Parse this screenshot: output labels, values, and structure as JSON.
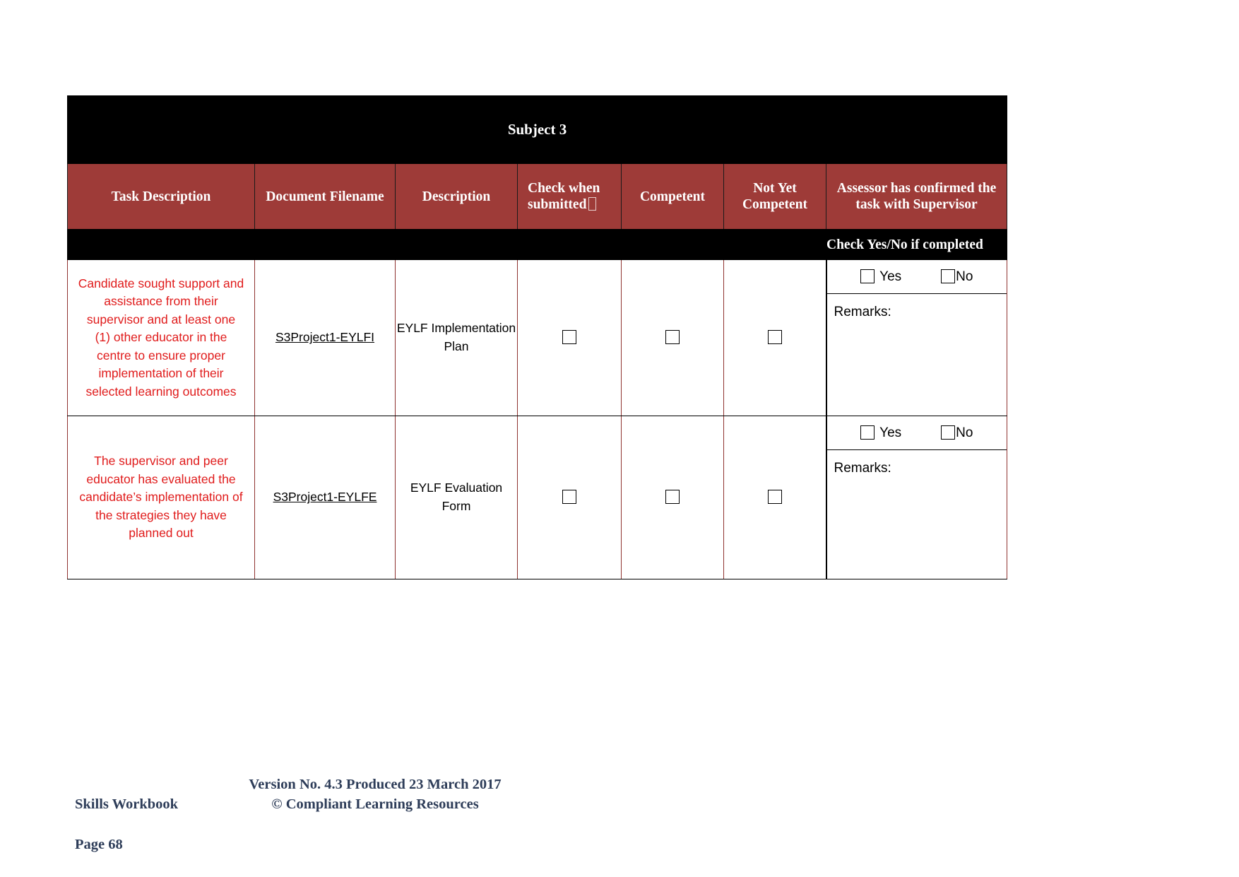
{
  "document": {
    "title": "Subject 3"
  },
  "table": {
    "columns": [
      "Task Description",
      "Document Filename",
      "Description",
      "Check when submitted",
      "Competent",
      "Not Yet Competent",
      "Assessor has confirmed the task with Supervisor"
    ],
    "subheader_note": "Check Yes/No if completed",
    "yes_label": "Yes",
    "no_label": "No",
    "remarks_label": "Remarks:",
    "rows": [
      {
        "task": "Candidate sought support and assistance from their supervisor and at least one (1) other educator in the centre to ensure proper implementation of their selected learning outcomes",
        "filename": "S3Project1-EYLFI",
        "description": "EYLF Implementation Plan",
        "check_when_submitted": false,
        "competent": false,
        "not_yet_competent": false,
        "assessor_yes": false,
        "assessor_no": false,
        "remarks": ""
      },
      {
        "task": "The supervisor and peer educator has evaluated the candidate’s implementation of the strategies they have planned out",
        "filename": "S3Project1-EYLFE",
        "description": "EYLF Evaluation Form",
        "check_when_submitted": false,
        "competent": false,
        "not_yet_competent": false,
        "assessor_yes": false,
        "assessor_no": false,
        "remarks": ""
      }
    ]
  },
  "footer": {
    "workbook": "Skills Workbook",
    "page": "Page 68",
    "version": "Version No. 4.3 Produced 23 March 2017",
    "copyright": "© Compliant Learning Resources"
  },
  "colors": {
    "header_red": "#9e3b38",
    "task_text_red": "#e01b1b",
    "footer_navy": "#2e3d59",
    "band_black": "#000000"
  }
}
